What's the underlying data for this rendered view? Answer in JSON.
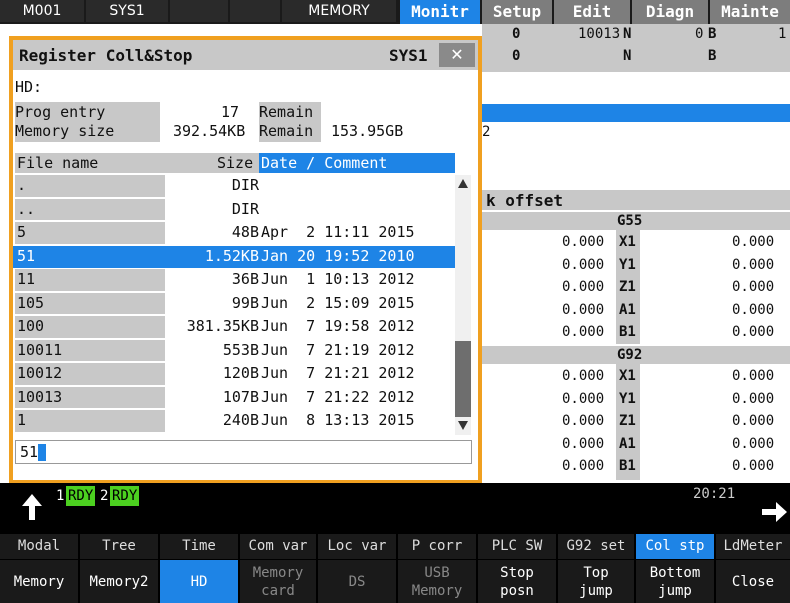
{
  "topbar": {
    "cells": [
      "M001",
      "SYS1",
      "",
      "",
      "MEMORY"
    ],
    "tabs": [
      "Monitr",
      "Setup",
      "Edit",
      "Diagn",
      "Mainte"
    ]
  },
  "background": {
    "row1": [
      "0",
      "10013",
      "N",
      "0",
      "B",
      "1"
    ],
    "row2": [
      "0",
      "N",
      "B"
    ],
    "num_2": "2",
    "work_offset_label": "k offset",
    "g55": "G55",
    "g92": "G92",
    "axes": [
      "X1",
      "Y1",
      "Z1",
      "A1",
      "B1"
    ],
    "left_values": [
      "0.000",
      "0.000",
      "0.000",
      "0.000",
      "0.000"
    ],
    "right_values": [
      "0.000",
      "0.000",
      "0.000",
      "0.000",
      "0.000"
    ],
    "left_values2": [
      "0.000",
      "0.000",
      "0.000",
      "0.000",
      "0.000"
    ],
    "right_values2": [
      "0.000",
      "0.000",
      "0.000",
      "0.000",
      "0.000"
    ]
  },
  "dialog": {
    "title": "Register Coll&Stop",
    "system": "SYS1",
    "close": "✕",
    "device": "HD:",
    "prog_entry_label": "Prog entry",
    "prog_entry_value": "17",
    "remain_label": "Remain",
    "memory_size_label": "Memory size",
    "memory_size_value": "392.54KB",
    "remain_value": "153.95GB",
    "col_filename": "File name",
    "col_size": "Size",
    "col_date": "Date / Comment",
    "files": [
      {
        "name": ".",
        "size": "DIR",
        "date": ""
      },
      {
        "name": "..",
        "size": "DIR",
        "date": ""
      },
      {
        "name": "5",
        "size": "48B",
        "date": "Apr  2 11:11 2015"
      },
      {
        "name": "51",
        "size": "1.52KB",
        "date": "Jan 20 19:52 2010"
      },
      {
        "name": "11",
        "size": "36B",
        "date": "Jun  1 10:13 2012"
      },
      {
        "name": "105",
        "size": "99B",
        "date": "Jun  2 15:09 2015"
      },
      {
        "name": "100",
        "size": "381.35KB",
        "date": "Jun  7 19:58 2012"
      },
      {
        "name": "10011",
        "size": "553B",
        "date": "Jun  7 21:19 2012"
      },
      {
        "name": "10012",
        "size": "120B",
        "date": "Jun  7 21:21 2012"
      },
      {
        "name": "10013",
        "size": "107B",
        "date": "Jun  7 21:22 2012"
      },
      {
        "name": "1",
        "size": "240B",
        "date": "Jun  8 13:13 2015"
      }
    ],
    "selected_index": 3,
    "input_value": "51"
  },
  "status": {
    "rdy1_num": "1",
    "rdy1": "RDY",
    "rdy2_num": "2",
    "rdy2": "RDY",
    "time": "20:21"
  },
  "menu_top": [
    "Modal",
    "Tree",
    "Time",
    "Com var",
    "Loc var",
    "P corr",
    "PLC SW",
    "G92 set",
    "Col stp",
    "LdMeter"
  ],
  "menu_bottom": [
    [
      "Memory"
    ],
    [
      "Memory2"
    ],
    [
      "HD"
    ],
    [
      "Memory",
      "card"
    ],
    [
      "DS"
    ],
    [
      "USB",
      "Memory"
    ],
    [
      "Stop",
      "posn"
    ],
    [
      "Top",
      "jump"
    ],
    [
      "Bottom",
      "jump"
    ],
    [
      "Close"
    ]
  ],
  "colors": {
    "accent": "#1e84e6",
    "dialog_border": "#f0a020",
    "ready": "#4cd020"
  }
}
